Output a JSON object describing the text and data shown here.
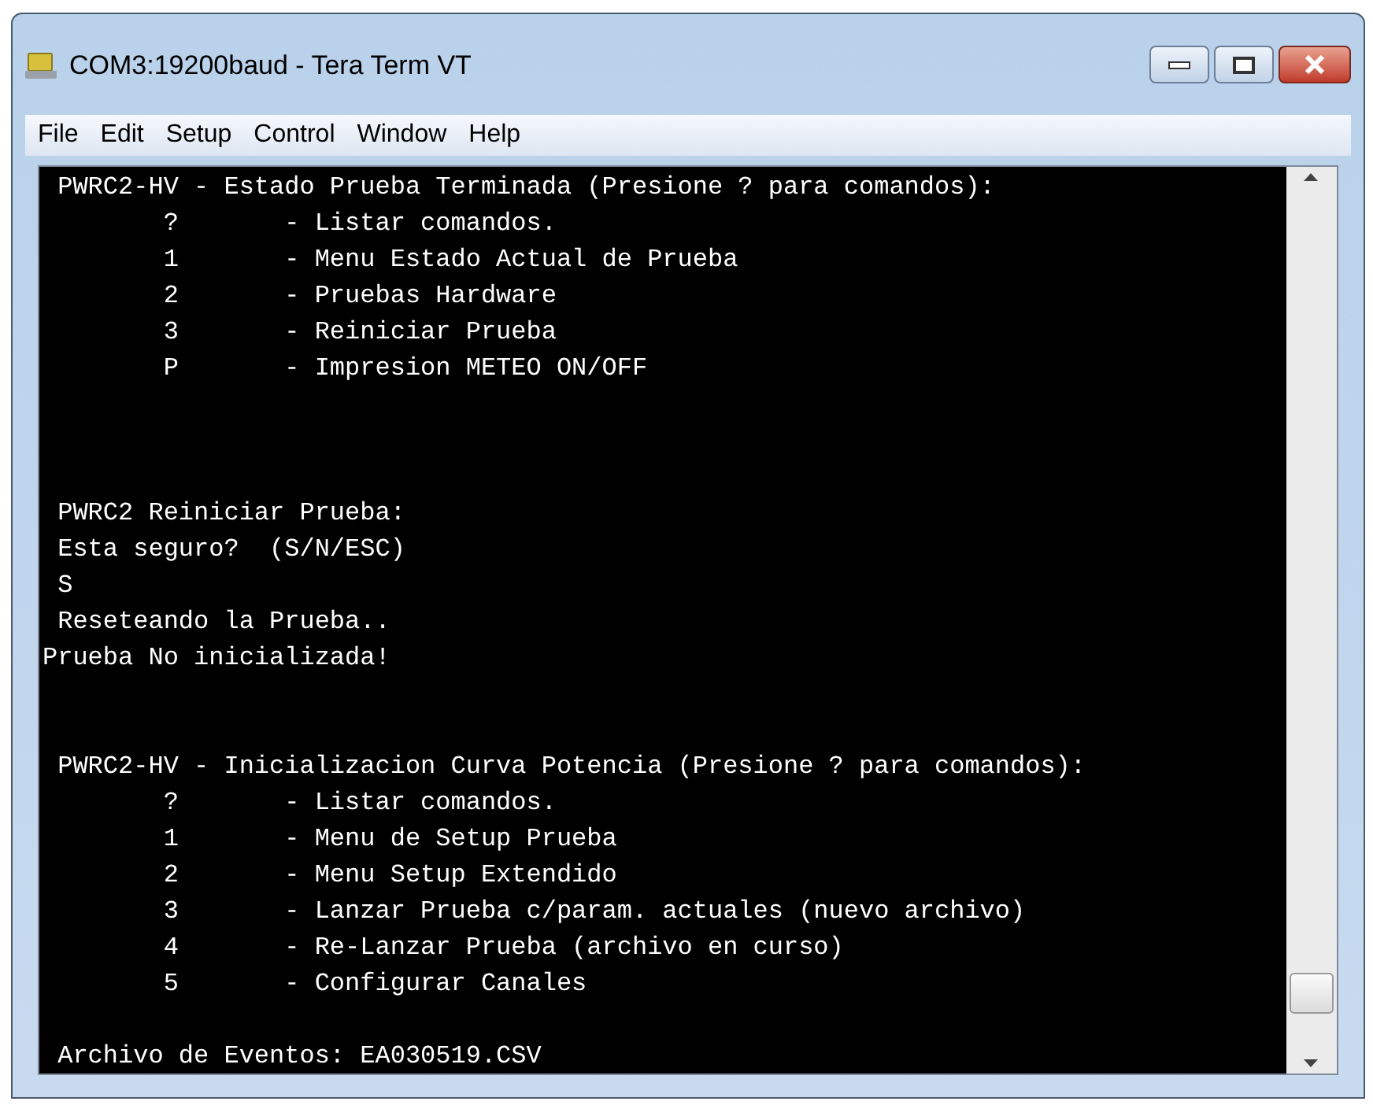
{
  "window": {
    "title": "COM3:19200baud - Tera Term VT"
  },
  "menu": [
    {
      "label": "File"
    },
    {
      "label": "Edit"
    },
    {
      "label": "Setup"
    },
    {
      "label": "Control"
    },
    {
      "label": "Window"
    },
    {
      "label": "Help"
    }
  ],
  "terminal": {
    "blocks": [
      {
        "lines": [
          " PWRC2-HV - Estado Prueba Terminada (Presione ? para comandos):",
          "        ?       - Listar comandos.",
          "        1       - Menu Estado Actual de Prueba",
          "        2       - Pruebas Hardware",
          "        3       - Reiniciar Prueba",
          "        P       - Impresion METEO ON/OFF"
        ]
      },
      {
        "lines": [
          " PWRC2 Reiniciar Prueba:",
          " Esta seguro?  (S/N/ESC)",
          " S",
          " Reseteando la Prueba..",
          "Prueba No inicializada!"
        ]
      },
      {
        "lines": [
          " PWRC2-HV - Inicializacion Curva Potencia (Presione ? para comandos):",
          "        ?       - Listar comandos.",
          "        1       - Menu de Setup Prueba",
          "        2       - Menu Setup Extendido",
          "        3       - Lanzar Prueba c/param. actuales (nuevo archivo)",
          "        4       - Re-Lanzar Prueba (archivo en curso)",
          "        5       - Configurar Canales"
        ]
      },
      {
        "lines": [
          " Archivo de Eventos: EA030519.CSV"
        ]
      }
    ]
  }
}
